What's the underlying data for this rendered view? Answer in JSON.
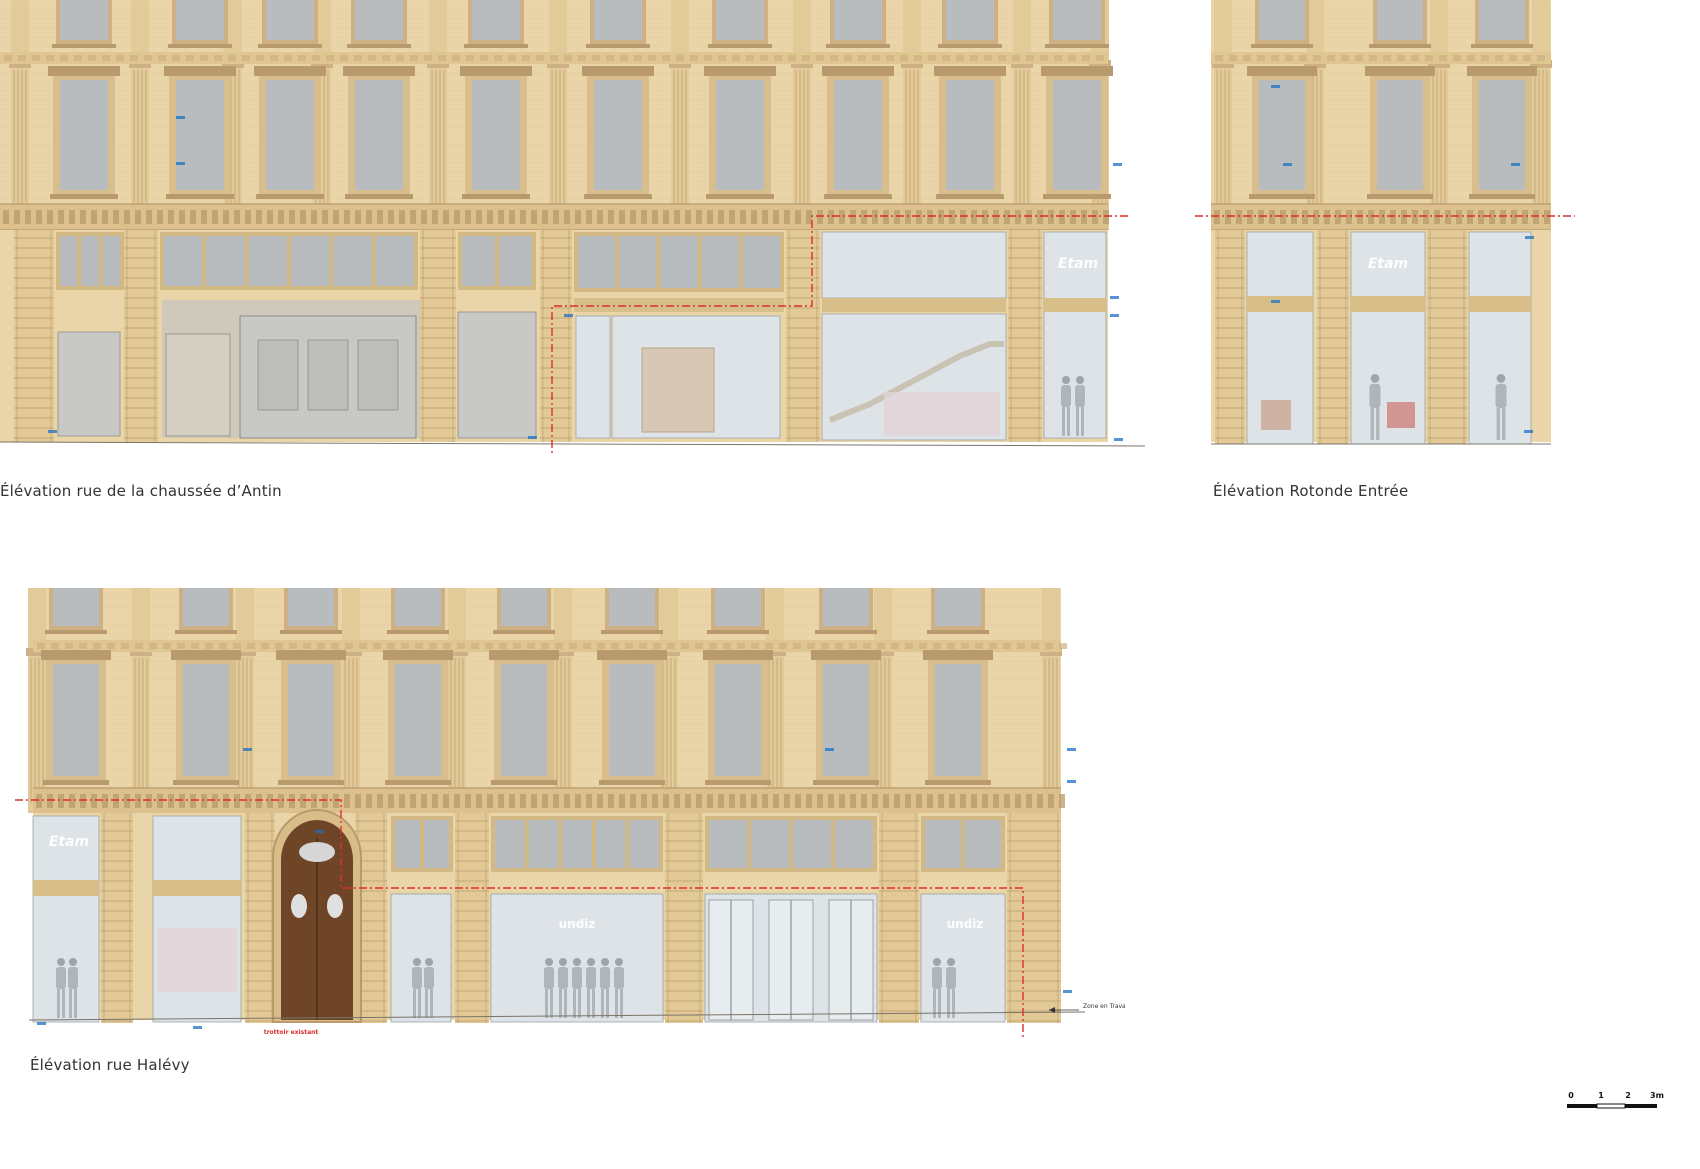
{
  "colors": {
    "stone": "#e9d5a8",
    "stone_dark": "#cdb184",
    "stone_shadow": "#b89a6c",
    "window_glass": "#b9bcbe",
    "shopfront_glass": "#dde3e7",
    "grey_shutter": "#c8c8c6",
    "cut_line": "#d9302c",
    "dimension": "#1f6fc4",
    "door_wood": "#6e4527"
  },
  "drawings": [
    {
      "id": "antin",
      "caption": "Élévation rue de la chaussée d’Antin",
      "signs": [
        "Etam"
      ]
    },
    {
      "id": "rotonde",
      "caption": "Élévation Rotonde Entrée",
      "signs": [
        "Etam"
      ]
    },
    {
      "id": "halevy",
      "caption": "Élévation rue Halévy",
      "signs": [
        "Etam",
        "undiz",
        "undiz"
      ],
      "note_sidewalk": "trottoir existant",
      "note_zone": "Zone en Travaux"
    }
  ],
  "scale": {
    "labels": [
      "0",
      "1",
      "2",
      "3m"
    ]
  }
}
